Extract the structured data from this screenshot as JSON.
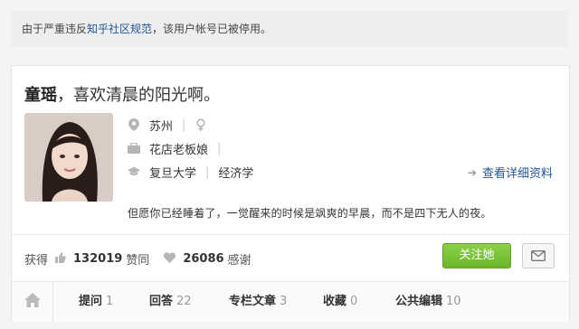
{
  "notice": {
    "prefix": "由于严重违反",
    "link": "知乎社区规范",
    "suffix": "，该用户帐号已被停用。"
  },
  "profile": {
    "name": "童瑶",
    "bio": "，喜欢清晨的阳光啊。",
    "location": "苏州",
    "business": "花店老板娘",
    "school": "复旦大学",
    "major": "经济学",
    "detail_link": "查看详细资料",
    "description": "但愿你已经睡着了，一觉醒来的时候是飒爽的早晨，而不是四下无人的夜。"
  },
  "stats": {
    "got_label": "获得",
    "agree_count": "132019",
    "agree_label": "赞同",
    "thanks_count": "26086",
    "thanks_label": "感谢"
  },
  "actions": {
    "follow_label": "关注她"
  },
  "tabs": [
    {
      "label": "提问",
      "count": "1"
    },
    {
      "label": "回答",
      "count": "22"
    },
    {
      "label": "专栏文章",
      "count": "3"
    },
    {
      "label": "收藏",
      "count": "0"
    },
    {
      "label": "公共编辑",
      "count": "10"
    }
  ],
  "colors": {
    "link": "#225599",
    "follow_button": "#6cb52a"
  }
}
